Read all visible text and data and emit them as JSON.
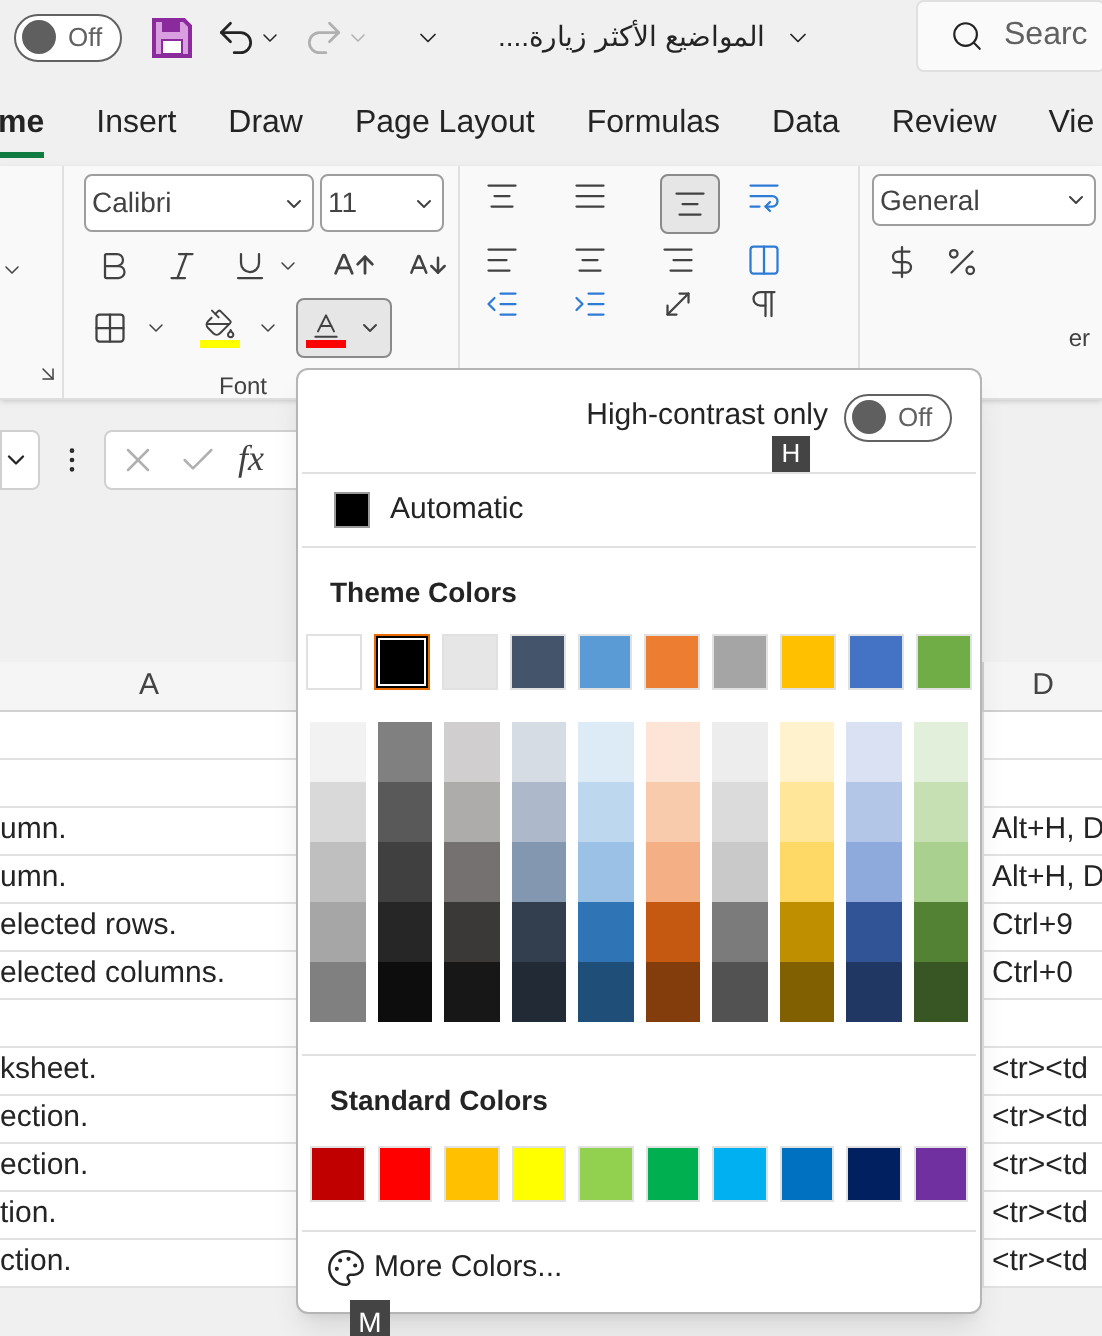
{
  "title_bar": {
    "autosave": {
      "label": "Off",
      "on": false
    },
    "document_title": "المواضيع الأكثر زيارة....",
    "search": {
      "placeholder": "Searc"
    }
  },
  "tabs": [
    {
      "label": "me",
      "selected": true
    },
    {
      "label": "Insert",
      "selected": false
    },
    {
      "label": "Draw",
      "selected": false
    },
    {
      "label": "Page Layout",
      "selected": false
    },
    {
      "label": "Formulas",
      "selected": false
    },
    {
      "label": "Data",
      "selected": false
    },
    {
      "label": "Review",
      "selected": false
    },
    {
      "label": "Vie",
      "selected": false
    }
  ],
  "ribbon": {
    "font_name": "Calibri",
    "font_size": "11",
    "font_group_label": "Font",
    "number_format": "General",
    "number_group_label": "er"
  },
  "formula_bar": {
    "function_label": "fx"
  },
  "grid": {
    "columns": [
      "A",
      "D"
    ],
    "rows": [
      {},
      {},
      {
        "a": "umn.",
        "d": "Alt+H, D"
      },
      {
        "a": "umn.",
        "d": "Alt+H, D"
      },
      {
        "a": "elected rows.",
        "d": "Ctrl+9"
      },
      {
        "a": "elected columns.",
        "d": "Ctrl+0"
      },
      {},
      {
        "a": "ksheet.",
        "d": "<tr><td"
      },
      {
        "a": "ection.",
        "d": "<tr><td"
      },
      {
        "a": "ection.",
        "d": "<tr><td"
      },
      {
        "a": "tion.",
        "d": "<tr><td"
      },
      {
        "a": "ction.",
        "d": "<tr><td"
      }
    ]
  },
  "color_menu": {
    "high_contrast": {
      "label": "High-contrast only",
      "toggle_label": "Off",
      "on": false,
      "keytip": "H"
    },
    "automatic": {
      "label": "Automatic",
      "color": "#000000"
    },
    "theme_title": "Theme Colors",
    "theme_colors": [
      {
        "color": "#ffffff",
        "selected": false
      },
      {
        "color": "#000000",
        "selected": true
      },
      {
        "color": "#e7e6e6",
        "selected": false
      },
      {
        "color": "#44546a",
        "selected": false
      },
      {
        "color": "#5b9bd5",
        "selected": false
      },
      {
        "color": "#ed7d31",
        "selected": false
      },
      {
        "color": "#a5a5a5",
        "selected": false
      },
      {
        "color": "#ffc000",
        "selected": false
      },
      {
        "color": "#4472c4",
        "selected": false
      },
      {
        "color": "#70ad47",
        "selected": false
      }
    ],
    "theme_shades": [
      [
        {
          "color": "#f2f2f2"
        },
        {
          "color": "#d9d9d9"
        },
        {
          "color": "#bfbfbf"
        },
        {
          "color": "#a6a6a6"
        },
        {
          "color": "#808080"
        }
      ],
      [
        {
          "color": "#808080"
        },
        {
          "color": "#595959"
        },
        {
          "color": "#404040"
        },
        {
          "color": "#262626"
        },
        {
          "color": "#0d0d0d"
        }
      ],
      [
        {
          "color": "#d0cece"
        },
        {
          "color": "#aeabab"
        },
        {
          "color": "#757171"
        },
        {
          "color": "#3b3838"
        },
        {
          "color": "#181717"
        }
      ],
      [
        {
          "color": "#d6dce4"
        },
        {
          "color": "#adb9ca"
        },
        {
          "color": "#8497b0"
        },
        {
          "color": "#333f4f"
        },
        {
          "color": "#222b35"
        }
      ],
      [
        {
          "color": "#ddebf7"
        },
        {
          "color": "#bdd7ee"
        },
        {
          "color": "#9bc2e6"
        },
        {
          "color": "#2f75b5"
        },
        {
          "color": "#1f4e78"
        }
      ],
      [
        {
          "color": "#fce4d6"
        },
        {
          "color": "#f8cbad"
        },
        {
          "color": "#f4b084"
        },
        {
          "color": "#c65911"
        },
        {
          "color": "#833c0c"
        }
      ],
      [
        {
          "color": "#ededed"
        },
        {
          "color": "#dbdbdb"
        },
        {
          "color": "#c9c9c9"
        },
        {
          "color": "#7b7b7b"
        },
        {
          "color": "#525252"
        }
      ],
      [
        {
          "color": "#fff2cc"
        },
        {
          "color": "#ffe699"
        },
        {
          "color": "#ffd966"
        },
        {
          "color": "#bf8f00"
        },
        {
          "color": "#806000"
        }
      ],
      [
        {
          "color": "#d9e1f2"
        },
        {
          "color": "#b4c6e7"
        },
        {
          "color": "#8ea9db"
        },
        {
          "color": "#305496"
        },
        {
          "color": "#203764"
        }
      ],
      [
        {
          "color": "#e2efda"
        },
        {
          "color": "#c6e0b4"
        },
        {
          "color": "#a9d08e"
        },
        {
          "color": "#548235"
        },
        {
          "color": "#375623"
        }
      ]
    ],
    "standard_title": "Standard Colors",
    "standard_colors": [
      {
        "color": "#c00000"
      },
      {
        "color": "#ff0000"
      },
      {
        "color": "#ffc000"
      },
      {
        "color": "#ffff00"
      },
      {
        "color": "#92d050"
      },
      {
        "color": "#00b050"
      },
      {
        "color": "#00b0f0"
      },
      {
        "color": "#0070c0"
      },
      {
        "color": "#002060"
      },
      {
        "color": "#7030a0"
      }
    ],
    "more_colors": {
      "label": "More Colors...",
      "keytip": "M"
    }
  }
}
